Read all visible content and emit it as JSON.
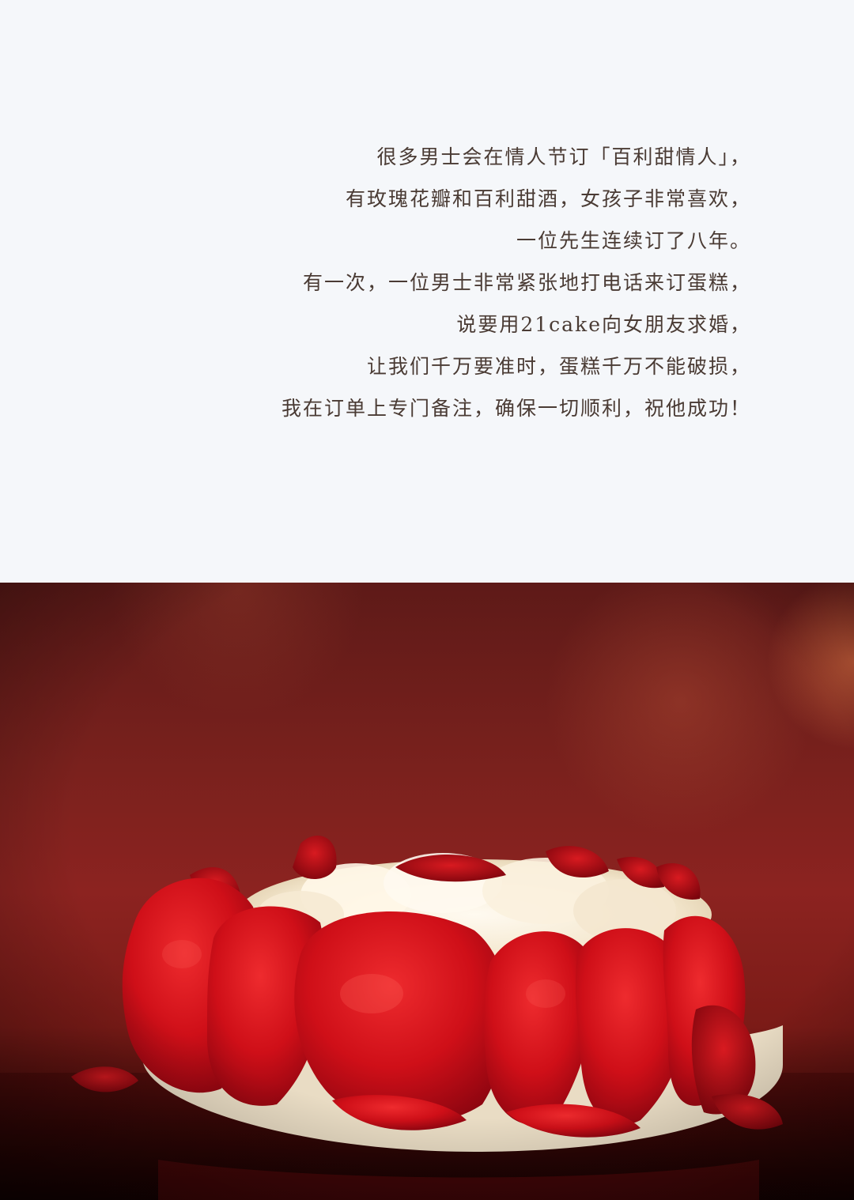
{
  "story": {
    "lines": [
      "很多男士会在情人节订「百利甜情人」，",
      "有玫瑰花瓣和百利甜酒，女孩子非常喜欢，",
      "一位先生连续订了八年。",
      "有一次，一位男士非常紧张地打电话来订蛋糕，",
      "说要用21cake向女朋友求婚，",
      "让我们千万要准时，蛋糕千万不能破损，",
      "我在订单上专门备注，确保一切顺利，祝他成功！"
    ]
  },
  "photo": {
    "subject": "rose-petal-cake",
    "colors": {
      "background": "#8c2320",
      "petal": "#d0101a",
      "cream": "#f7ecd6"
    }
  }
}
